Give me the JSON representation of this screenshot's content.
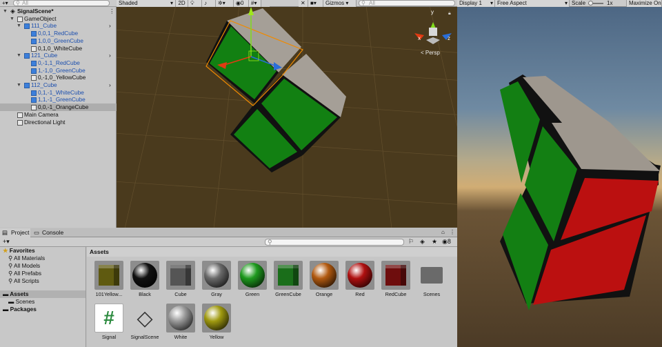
{
  "hierarchy": {
    "search_placeholder": "All",
    "rows": [
      {
        "label": "SignalScene*",
        "indent": 0,
        "expanded": true,
        "icon": "scene-icon",
        "bold": true,
        "blue": false,
        "menu": true
      },
      {
        "label": "GameObject",
        "indent": 1,
        "expanded": true,
        "icon": "gameobject-icon",
        "bold": false,
        "blue": false
      },
      {
        "label": "111_Cube",
        "indent": 2,
        "expanded": true,
        "icon": "prefab-icon",
        "bold": false,
        "blue": true,
        "arrow": true
      },
      {
        "label": "0,0,1_RedCube",
        "indent": 3,
        "icon": "prefab-cube-icon",
        "blue": true
      },
      {
        "label": "1,0,0_GreenCube",
        "indent": 3,
        "icon": "prefab-cube-icon",
        "blue": true
      },
      {
        "label": "0,1,0_WhiteCube",
        "indent": 3,
        "icon": "cube-icon",
        "blue": false
      },
      {
        "label": "121_Cube",
        "indent": 2,
        "expanded": true,
        "icon": "prefab-icon",
        "blue": true,
        "arrow": true
      },
      {
        "label": "0,-1,1_RedCube",
        "indent": 3,
        "icon": "prefab-cube-icon",
        "blue": true
      },
      {
        "label": "1,-1,0_GreenCube",
        "indent": 3,
        "icon": "prefab-cube-icon",
        "blue": true
      },
      {
        "label": "0,-1,0_YellowCube",
        "indent": 3,
        "icon": "cube-icon",
        "blue": false
      },
      {
        "label": "112_Cube",
        "indent": 2,
        "expanded": true,
        "icon": "prefab-icon",
        "blue": true,
        "arrow": true
      },
      {
        "label": "0,1,-1_WhiteCube",
        "indent": 3,
        "icon": "prefab-cube-icon",
        "blue": true
      },
      {
        "label": "1,1,-1_GreenCube",
        "indent": 3,
        "icon": "prefab-cube-icon",
        "blue": true
      },
      {
        "label": "0,0,-1_OrangeCube",
        "indent": 3,
        "icon": "cube-icon",
        "blue": false,
        "selected": true
      },
      {
        "label": "Main Camera",
        "indent": 1,
        "icon": "camera-icon",
        "blue": false
      },
      {
        "label": "Directional Light",
        "indent": 1,
        "icon": "light-icon",
        "blue": false
      }
    ]
  },
  "scene_toolbar": {
    "shading": "Shaded",
    "mode_2d": "2D",
    "hidden_count": "0",
    "gizmos": "Gizmos",
    "search_placeholder": "All"
  },
  "scene": {
    "persp_label": "< Persp",
    "axis_x": "x",
    "axis_y": "y",
    "axis_z": "z"
  },
  "game_toolbar": {
    "display": "Display 1",
    "aspect": "Free Aspect",
    "scale_label": "Scale",
    "scale_value": "1x",
    "maximize": "Maximize On"
  },
  "project": {
    "tabs": [
      "Project",
      "Console"
    ],
    "hidden_count": "8",
    "favorites_label": "Favorites",
    "favorites": [
      "All Materials",
      "All Models",
      "All Prefabs",
      "All Scripts"
    ],
    "assets_label": "Assets",
    "assets_children": [
      "Scenes"
    ],
    "packages_label": "Packages",
    "grid_title": "Assets",
    "assets": [
      {
        "name": "101Yellow...",
        "kind": "cube",
        "color": "#5f5a10"
      },
      {
        "name": "Black",
        "kind": "sphere",
        "color": "#111111"
      },
      {
        "name": "Cube",
        "kind": "cube",
        "color": "#555555"
      },
      {
        "name": "Gray",
        "kind": "sphere",
        "color": "#6a6a6a"
      },
      {
        "name": "Green",
        "kind": "sphere",
        "color": "#1e9a1e"
      },
      {
        "name": "GreenCube",
        "kind": "cube",
        "color": "#1a6e1a"
      },
      {
        "name": "Orange",
        "kind": "sphere",
        "color": "#b25a10"
      },
      {
        "name": "Red",
        "kind": "sphere",
        "color": "#b01010"
      },
      {
        "name": "RedCube",
        "kind": "cube",
        "color": "#6e0d0d"
      },
      {
        "name": "Scenes",
        "kind": "folder",
        "color": "#6a6a6a"
      },
      {
        "name": "Signal",
        "kind": "script",
        "color": "#2b8a3e"
      },
      {
        "name": "SignalScene",
        "kind": "unity",
        "color": "#333333"
      },
      {
        "name": "White",
        "kind": "sphere",
        "color": "#9a9a9a"
      },
      {
        "name": "Yellow",
        "kind": "sphere",
        "color": "#a09a10"
      }
    ]
  }
}
